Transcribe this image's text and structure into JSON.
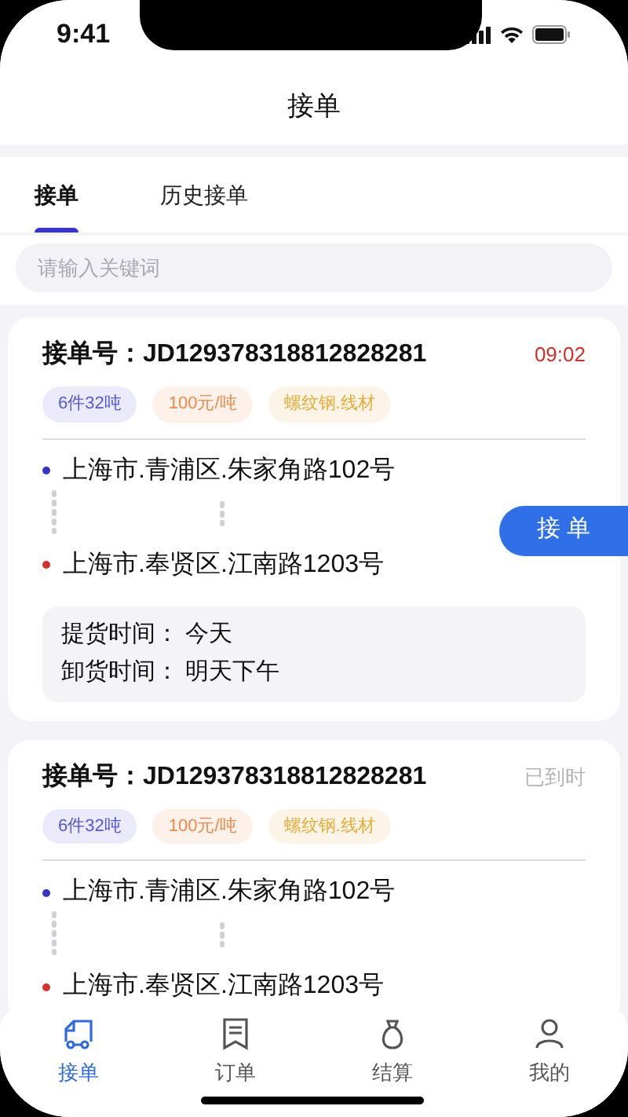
{
  "status_bar": {
    "time": "9:41"
  },
  "header": {
    "title": "接单"
  },
  "tabs": [
    {
      "label": "接单",
      "selected": true
    },
    {
      "label": "历史接单",
      "selected": false
    }
  ],
  "search": {
    "placeholder": "请输入关键词"
  },
  "orders": [
    {
      "order_no_label": "接单号：",
      "order_no": "JD129378318812828281",
      "status": "09:02",
      "expired": false,
      "tags": [
        {
          "text": "6件32吨",
          "color": "#5656d8"
        },
        {
          "text": "100元/吨",
          "color": "#ef8a4a"
        },
        {
          "text": "螺纹钢.线材",
          "color": "#e6ad3a"
        }
      ],
      "from": "上海市.青浦区.朱家角路102号",
      "to": "上海市.奉贤区.江南路1203号",
      "action": "接 单",
      "times": [
        {
          "label": "提货时间：",
          "value": "今天"
        },
        {
          "label": "卸货时间：",
          "value": "明天下午"
        }
      ]
    },
    {
      "order_no_label": "接单号：",
      "order_no": "JD129378318812828281",
      "status": "已到时",
      "expired": true,
      "tags": [
        {
          "text": "6件32吨",
          "color": "#5656d8"
        },
        {
          "text": "100元/吨",
          "color": "#ef8a4a"
        },
        {
          "text": "螺纹钢.线材",
          "color": "#e6ad3a"
        }
      ],
      "from": "上海市.青浦区.朱家角路102号",
      "to": "上海市.奉贤区.江南路1203号"
    }
  ],
  "bottom_nav": [
    {
      "label": "接单",
      "selected": true,
      "kind": "truck"
    },
    {
      "label": "订单",
      "selected": false,
      "kind": "document"
    },
    {
      "label": "结算",
      "selected": false,
      "kind": "bag"
    },
    {
      "label": "我的",
      "selected": false,
      "kind": "person"
    }
  ]
}
